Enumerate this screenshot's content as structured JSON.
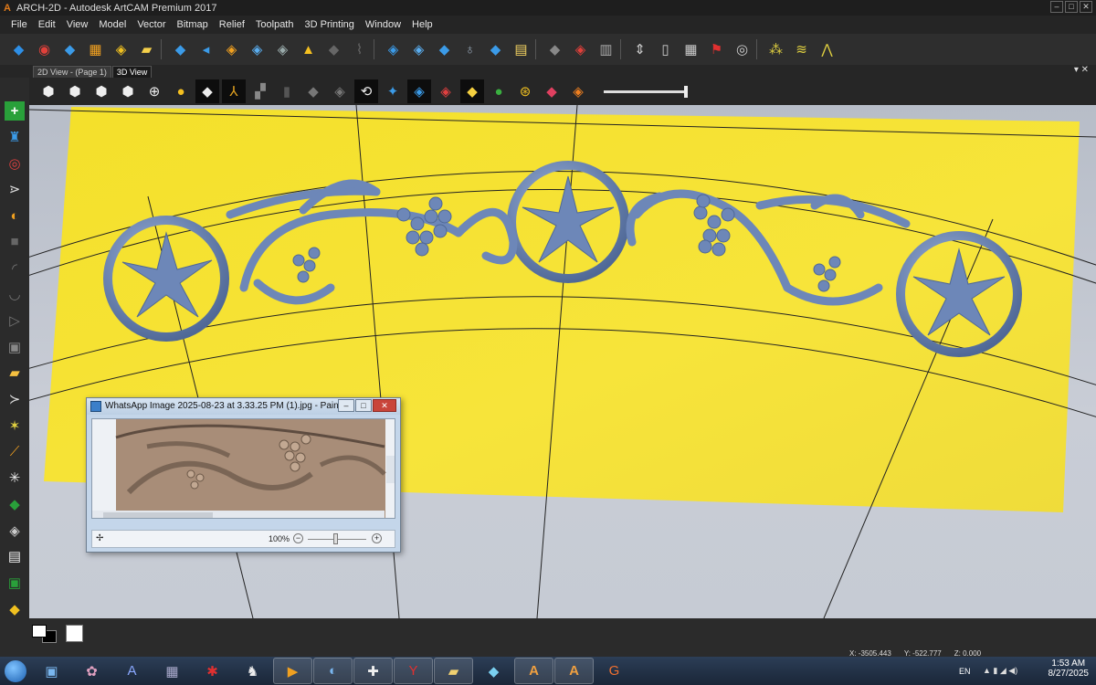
{
  "window": {
    "title": "ARCH-2D - Autodesk ArtCAM Premium 2017",
    "logo_letter": "A"
  },
  "menu": [
    "File",
    "Edit",
    "View",
    "Model",
    "Vector",
    "Bitmap",
    "Relief",
    "Toolpath",
    "3D Printing",
    "Window",
    "Help"
  ],
  "toolbar_icons": [
    "new-model-icon",
    "merge-icon",
    "select-icon",
    "texture-icon",
    "layers-icon",
    "open-folder-icon",
    "relief-blue-icon",
    "relief-arrow-icon",
    "pattern-icon",
    "stack-icon",
    "hatch-icon",
    "warning-icon",
    "grey-relief-icon",
    "paint-icon",
    "wave-icon",
    "bevel-icon",
    "dome-icon",
    "extrude-icon",
    "spin-icon",
    "lines-icon",
    "fill-icon",
    "cut-icon",
    "arrow-down-icon",
    "resize-icon",
    "split-icon",
    "grid-icon",
    "flag-icon",
    "dots-circle-icon",
    "nodes-icon",
    "waves-icon",
    "line-nodes-icon"
  ],
  "tabs": [
    {
      "label": "2D View -  (Page 1)",
      "active": false
    },
    {
      "label": "3D View",
      "active": true
    }
  ],
  "view_icons": [
    "view-top-icon",
    "view-iso1-icon",
    "view-iso2-icon",
    "view-iso3-icon",
    "zoom-icon",
    "light-icon",
    "plane-icon",
    "axis-icon",
    "puzzle-icon",
    "bottle-icon",
    "grey-box-icon",
    "grey-box2-icon",
    "rotate-icon",
    "star-icon",
    "blue-layer-icon",
    "red-layer-icon",
    "gold-layer-icon",
    "green-shape-icon",
    "search-relief-icon",
    "color-stack-icon",
    "rainbow-icon"
  ],
  "left_icons": [
    "add-icon",
    "paint-bucket-icon",
    "target-icon",
    "vector-tool-icon",
    "split-vector-icon",
    "square-icon",
    "arc-icon",
    "curve-icon",
    "triangle-icon",
    "node-icon",
    "folder-star-icon",
    "arrow-icon",
    "star-tool-icon",
    "brush-icon",
    "snowflake-icon",
    "relief-layer-icon",
    "stack-layer-icon",
    "page-icon",
    "copy-icon",
    "gold-block-icon"
  ],
  "paint": {
    "title": "WhatsApp Image 2025-08-23 at 3.33.25 PM (1).jpg - Paint",
    "zoom": "100%",
    "minimize": "–",
    "maximize": "□",
    "close": "✕"
  },
  "status": {
    "x": "X: -3505.443",
    "y": "Y: -522.777",
    "z": "Z: 0.000"
  },
  "taskbar_apps": [
    "explorer",
    "settings-app",
    "artcam-a",
    "calculator",
    "cube-app",
    "sheep-app",
    "video-app",
    "paint-app",
    "blender-app",
    "yahoo-app",
    "folder-app",
    "blue-app",
    "artcam-orange-1",
    "artcam-orange-2",
    "gmail-app"
  ],
  "tray": {
    "lang": "EN",
    "time": "1:53 AM",
    "date": "8/27/2025"
  },
  "colors": {
    "panel_yellow": "#f7e33a",
    "relief_blue": "#6d87b8",
    "viewport_bg": "#c2c7d0"
  }
}
